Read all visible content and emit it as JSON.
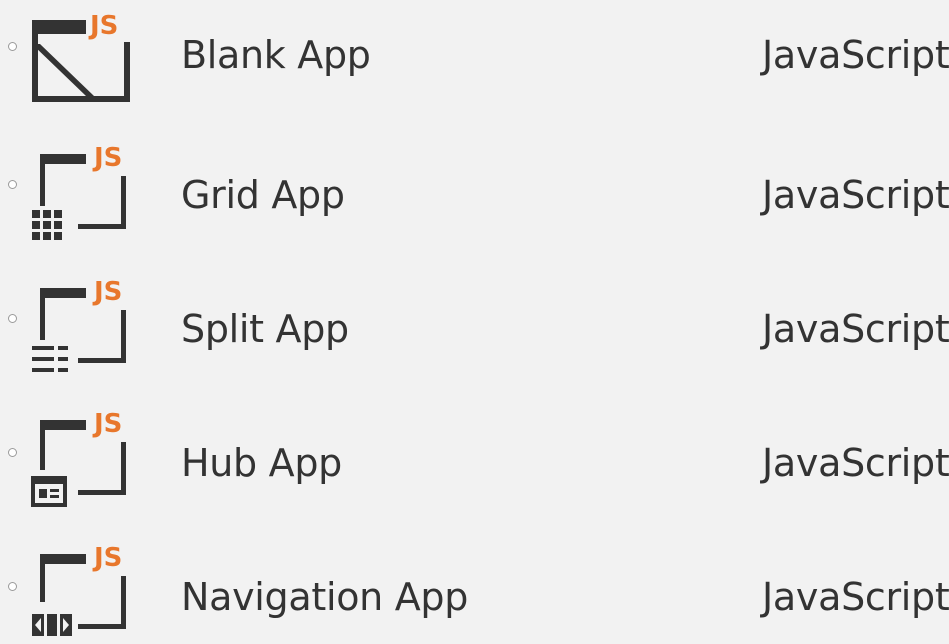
{
  "accent_color": "#e8772c",
  "templates": [
    {
      "name": "Blank App",
      "language": "JavaScript",
      "badge": "JS",
      "icon": "blank-app-icon"
    },
    {
      "name": "Grid App",
      "language": "JavaScript",
      "badge": "JS",
      "icon": "grid-app-icon"
    },
    {
      "name": "Split App",
      "language": "JavaScript",
      "badge": "JS",
      "icon": "split-app-icon"
    },
    {
      "name": "Hub App",
      "language": "JavaScript",
      "badge": "JS",
      "icon": "hub-app-icon"
    },
    {
      "name": "Navigation App",
      "language": "JavaScript",
      "badge": "JS",
      "icon": "navigation-app-icon"
    }
  ]
}
